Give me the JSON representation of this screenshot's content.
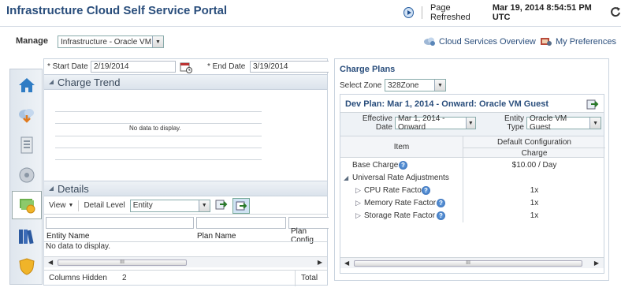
{
  "header": {
    "title": "Infrastructure Cloud Self Service Portal",
    "refreshed_label": "Page Refreshed",
    "refreshed_value": "Mar 19, 2014 8:54:51 PM UTC"
  },
  "manage": {
    "label": "Manage",
    "selected": "Infrastructure - Oracle VM"
  },
  "links": {
    "cloud_overview": "Cloud Services Overview",
    "preferences": "My Preferences"
  },
  "dates": {
    "start_label": "* Start Date",
    "start_value": "2/19/2014",
    "end_label": "* End Date",
    "end_value": "3/19/2014"
  },
  "charge_trend": {
    "title": "Charge Trend",
    "empty": "No data to display."
  },
  "details": {
    "title": "Details",
    "view_label": "View",
    "detail_level_label": "Detail Level",
    "detail_level_value": "Entity",
    "columns": [
      "Entity Name",
      "Plan Name",
      "Plan Config"
    ],
    "empty": "No data to display.",
    "columns_hidden_label": "Columns Hidden",
    "columns_hidden_value": "2",
    "total_label": "Total",
    "scroll_thumb": "III"
  },
  "charge_plans": {
    "title": "Charge Plans",
    "zone_label": "Select Zone",
    "zone_value": "328Zone",
    "plan_title": "Dev Plan: Mar 1, 2014 - Onward: Oracle VM Guest",
    "effective_label_1": "Effective",
    "effective_label_2": "Date",
    "effective_value": "Mar 1, 2014 - Onward",
    "entity_label_1": "Entity",
    "entity_label_2": "Type",
    "entity_value": "Oracle VM Guest",
    "col_item": "Item",
    "col_config": "Default Configuration",
    "col_charge": "Charge",
    "rows": [
      {
        "label": "Base Charge",
        "value": "$10.00 / Day"
      },
      {
        "label": "Universal Rate Adjustments",
        "value": ""
      },
      {
        "label": "CPU Rate Factor",
        "value": "1x"
      },
      {
        "label": "Memory Rate Factor",
        "value": "1x"
      },
      {
        "label": "Storage Rate Factor",
        "value": "1x"
      }
    ],
    "scroll_thumb": "III"
  },
  "icons": {
    "play": "play-icon",
    "refresh": "refresh-icon",
    "cloud_overview": "cloud-icon",
    "preferences": "preferences-icon",
    "calendar": "calendar-icon",
    "export": "export-icon",
    "help": "help-icon",
    "side": [
      "home-icon",
      "cloud-download-icon",
      "document-icon",
      "disc-icon",
      "chargeback-icon",
      "library-icon",
      "shield-icon"
    ]
  }
}
